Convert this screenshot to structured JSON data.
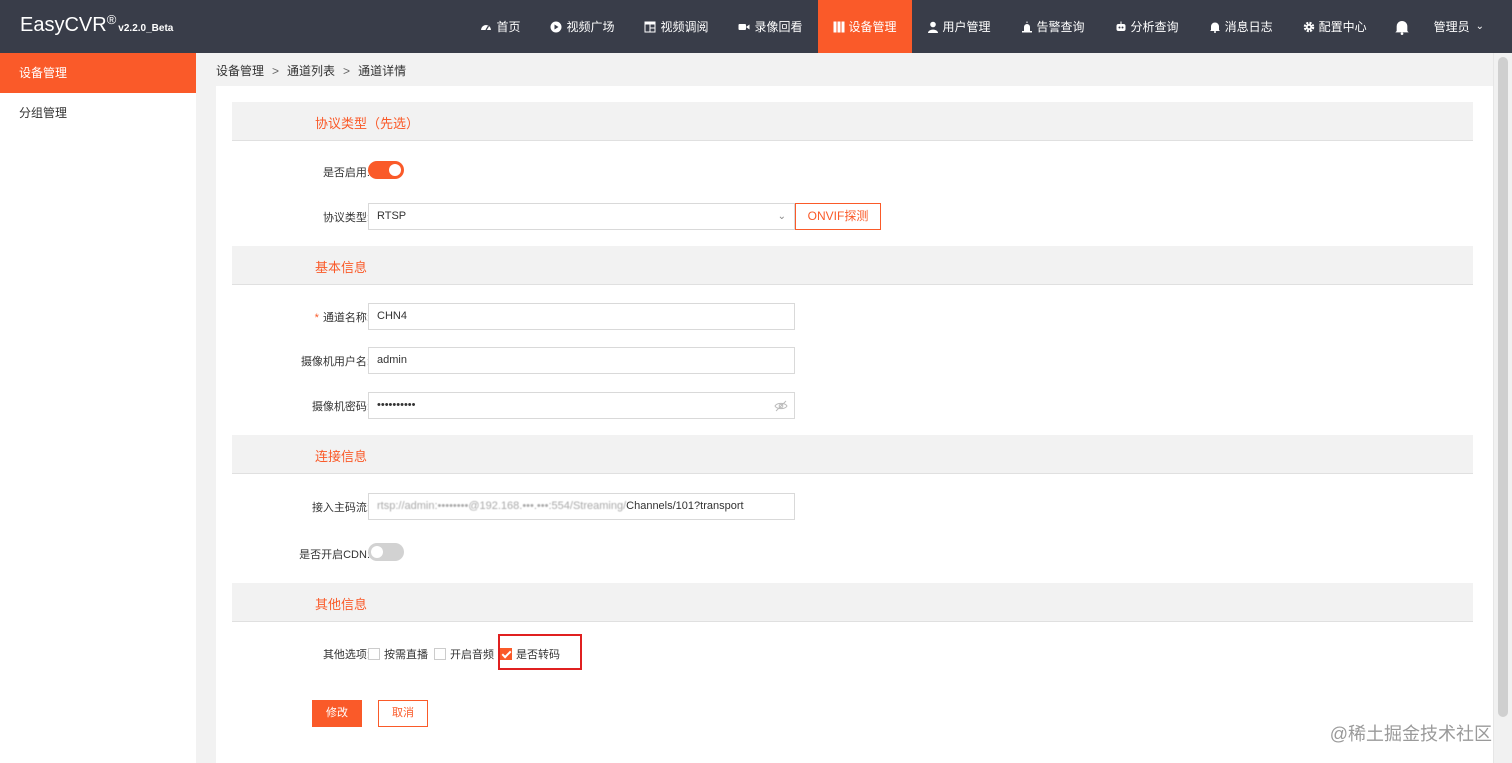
{
  "app": {
    "logo_text": "EasyCVR",
    "logo_mark": "®",
    "version": "v2.2.0_Beta"
  },
  "nav": {
    "items": [
      {
        "label": "首页",
        "icon": "dashboard-icon"
      },
      {
        "label": "视频广场",
        "icon": "play-circle-icon"
      },
      {
        "label": "视频调阅",
        "icon": "layout-icon"
      },
      {
        "label": "录像回看",
        "icon": "video-camera-icon"
      },
      {
        "label": "设备管理",
        "icon": "columns-icon",
        "active": true
      },
      {
        "label": "用户管理",
        "icon": "user-icon"
      },
      {
        "label": "告警查询",
        "icon": "alarm-icon"
      },
      {
        "label": "分析查询",
        "icon": "robot-icon"
      },
      {
        "label": "消息日志",
        "icon": "bell-icon"
      },
      {
        "label": "配置中心",
        "icon": "gear-icon"
      }
    ],
    "admin_label": "管理员"
  },
  "sidebar": {
    "items": [
      {
        "label": "设备管理",
        "active": true
      },
      {
        "label": "分组管理",
        "active": false
      }
    ]
  },
  "breadcrumb": {
    "items": [
      "设备管理",
      "通道列表",
      "通道详情"
    ],
    "separator": ">"
  },
  "sections": {
    "protocol": "协议类型（先选）",
    "basic": "基本信息",
    "connection": "连接信息",
    "other": "其他信息"
  },
  "form": {
    "enabled_label": "是否启用:",
    "enabled": true,
    "protocol_label": "协议类型:",
    "protocol_value": "RTSP",
    "onvif_button": "ONVIF探测",
    "channel_name_required": "*",
    "channel_name_label": "通道名称:",
    "channel_name_value": "CHN4",
    "camera_user_label": "摄像机用户名:",
    "camera_user_value": "admin",
    "camera_password_label": "摄像机密码:",
    "camera_password_value": "••••••••••",
    "main_stream_label": "接入主码流:",
    "main_stream_value_blurred": "rtsp://admin:••••••••@192.168.•••.•••:554/Streaming/",
    "main_stream_value_visible": "Channels/101?transport",
    "cdn_label": "是否开启CDN:",
    "cdn_enabled": false,
    "other_options_label": "其他选项:",
    "options": [
      {
        "label": "按需直播",
        "checked": false
      },
      {
        "label": "开启音频",
        "checked": false
      },
      {
        "label": "是否转码",
        "checked": true
      }
    ],
    "submit_label": "修改",
    "cancel_label": "取消"
  },
  "watermark": "@稀土掘金技术社区",
  "colors": {
    "accent": "#fa5a29",
    "header_bg": "#393d49",
    "highlight_box": "#e02020"
  }
}
